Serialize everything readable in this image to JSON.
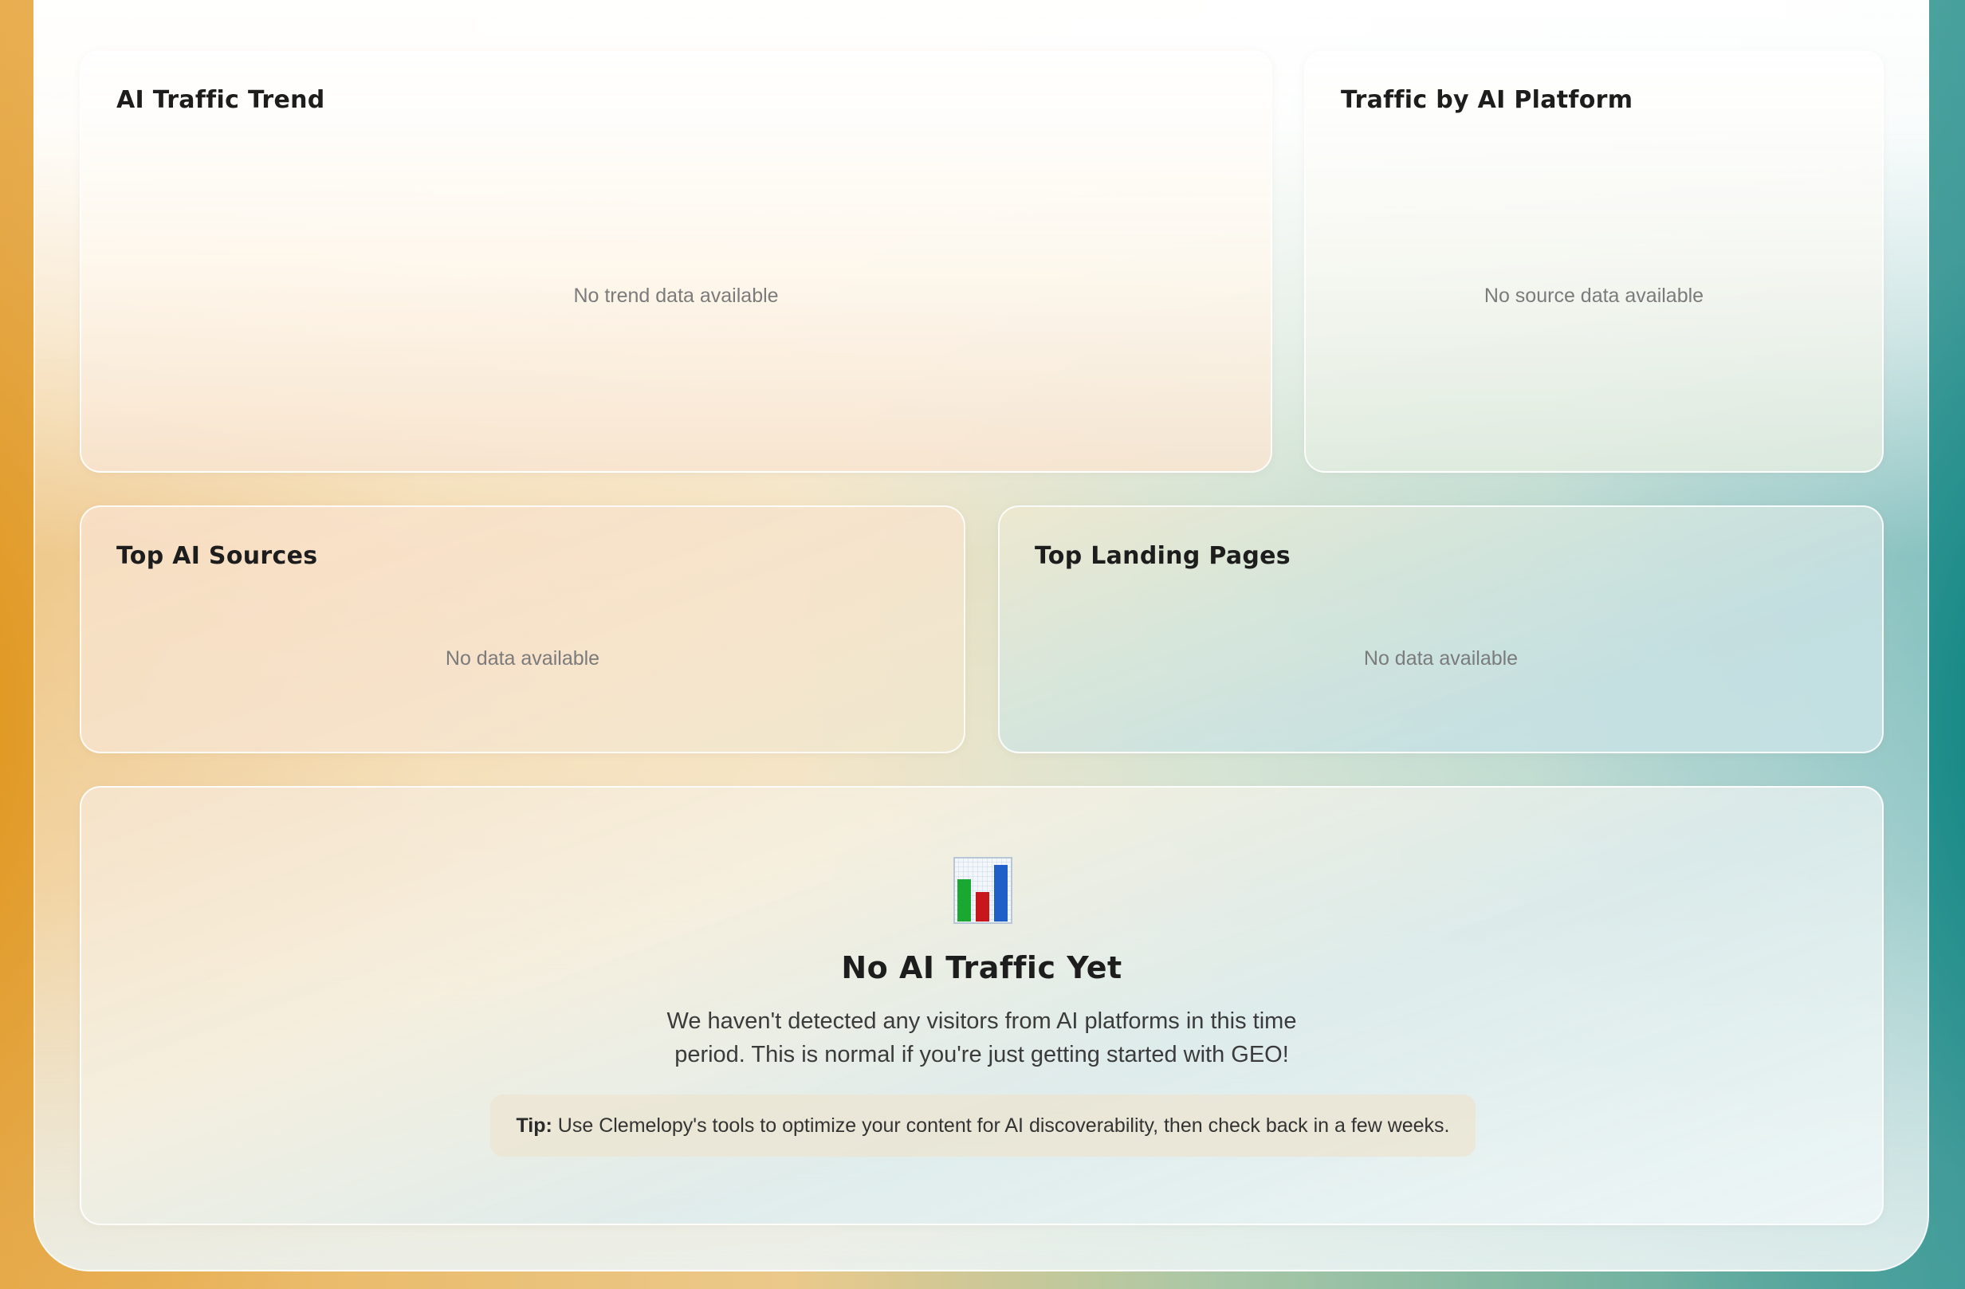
{
  "cards": {
    "trend": {
      "title": "AI Traffic Trend",
      "empty": "No trend data available"
    },
    "platform": {
      "title": "Traffic by AI Platform",
      "empty": "No source data available"
    },
    "sources": {
      "title": "Top AI Sources",
      "empty": "No data available"
    },
    "landing": {
      "title": "Top Landing Pages",
      "empty": "No data available"
    }
  },
  "empty_state": {
    "icon": "bar-chart-icon",
    "title": "No AI Traffic Yet",
    "description": "We haven't detected any visitors from AI platforms in this time period. This is normal if you're just getting started with GEO!",
    "tip_label": "Tip:",
    "tip_text": " Use Clemelopy's tools to optimize your content for AI discoverability, then check back in a few weeks."
  },
  "colors": {
    "accent_orange": "#de9214",
    "accent_teal": "#00807d",
    "icon_green": "#1aa832",
    "icon_red": "#c8171c",
    "icon_blue": "#1f5fc7"
  }
}
